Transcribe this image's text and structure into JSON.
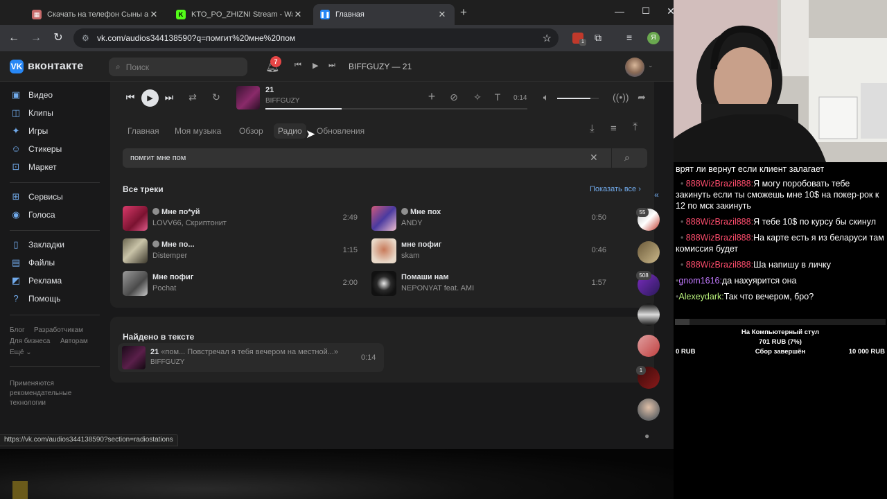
{
  "browser": {
    "tabs": [
      {
        "title": "Скачать на телефон Сыны ана",
        "favicon": "video-site-icon"
      },
      {
        "title": "KTO_PO_ZHIZNI Stream - Watc",
        "favicon": "kick-icon"
      },
      {
        "title": "Главная",
        "favicon": "pause-icon"
      }
    ],
    "new_tab": "+",
    "url": "vk.com/audios344138590?q=помгит%20мне%20пом",
    "profile_letter": "Я",
    "extension_badge": "1",
    "status_url": "https://vk.com/audios344138590?section=radiostations"
  },
  "vk_header": {
    "logo_text": "вконтакте",
    "search_placeholder": "Поиск",
    "notifications_count": "7",
    "now_playing": "BIFFGUZY — 21"
  },
  "sidebar": {
    "items": [
      {
        "label": "Видео",
        "icon": "video-icon"
      },
      {
        "label": "Клипы",
        "icon": "clips-icon"
      },
      {
        "label": "Игры",
        "icon": "games-icon"
      },
      {
        "label": "Стикеры",
        "icon": "stickers-icon"
      },
      {
        "label": "Маркет",
        "icon": "market-icon"
      },
      {
        "label": "Сервисы",
        "icon": "services-icon"
      },
      {
        "label": "Голоса",
        "icon": "votes-icon"
      },
      {
        "label": "Закладки",
        "icon": "bookmarks-icon"
      },
      {
        "label": "Файлы",
        "icon": "files-icon"
      },
      {
        "label": "Реклама",
        "icon": "ads-icon"
      },
      {
        "label": "Помощь",
        "icon": "help-icon"
      }
    ],
    "footer_links": [
      "Блог",
      "Разработчикам",
      "Для бизнеса",
      "Авторам",
      "Ещё"
    ],
    "recommend_note": "Применяются рекомендательные технологии"
  },
  "player": {
    "track_title": "21",
    "track_artist": "BIFFGUZY",
    "elapsed": "0:14",
    "progress": 0.29,
    "volume": 0.8
  },
  "music": {
    "tabs": [
      "Главная",
      "Моя музыка",
      "Обзор",
      "Радио",
      "Обновления"
    ],
    "search_value": "помгит мне пом",
    "all_tracks_heading": "Все треки",
    "show_all": "Показать все",
    "tracks": [
      {
        "title": "Мне по*уй",
        "artist": "LOVV66, Скриптонит",
        "duration": "2:49",
        "explicit": true
      },
      {
        "title": "Мне по...",
        "artist": "Distemper",
        "duration": "1:15",
        "explicit": true
      },
      {
        "title": "Мне пофиг",
        "artist": "Pochat",
        "duration": "2:00",
        "explicit": false
      },
      {
        "title": "Мне пох",
        "artist": "ANDY",
        "duration": "0:50",
        "explicit": true
      },
      {
        "title": "мне пофиг",
        "artist": "skam",
        "duration": "0:46",
        "explicit": false
      },
      {
        "title": "Помаши нам",
        "artist": "NEPONYAT feat. AMI",
        "duration": "1:57",
        "explicit": false
      }
    ],
    "found_in_text_heading": "Найдено в тексте",
    "lyrics_result": {
      "title": "21",
      "snippet": "«пом... Повстречал я тебя вечером на местной...»",
      "artist": "BIFFGUZY",
      "duration": "0:14"
    }
  },
  "right_rail": {
    "badges": [
      "55",
      "508",
      "1"
    ]
  },
  "stream_chat": {
    "first_line": "врят ли вернут если клиент залагает",
    "messages": [
      {
        "nick": "888WizBrazil888",
        "text": "Я могу поробовать тебе закинуть если ты сможешь мне 10$ на покер-рок к 12 по мск закинуть",
        "color": "#ff4d6d"
      },
      {
        "nick": "888WizBrazil888",
        "text": "Я тебе 10$ по курсу бы скинул",
        "color": "#ff4d6d"
      },
      {
        "nick": "888WizBrazil888",
        "text": "На карте есть я из беларуси там комиссия будет",
        "color": "#ff4d6d"
      },
      {
        "nick": "888WizBrazil888",
        "text": "Ша напишу в личку",
        "color": "#ff4d6d"
      },
      {
        "nick": "gnom1616",
        "text": "да нахуярится она",
        "color": "#c27aff"
      },
      {
        "nick": "Alexeydark",
        "text": "Так что вечером, бро?",
        "color": "#b9f27c"
      }
    ]
  },
  "donation_goal": {
    "title": "На Компьютерный стул",
    "collected": "701 RUB (7%)",
    "min": "0 RUB",
    "status": "Сбор завершён",
    "max": "10 000 RUB",
    "progress": 0.07
  }
}
